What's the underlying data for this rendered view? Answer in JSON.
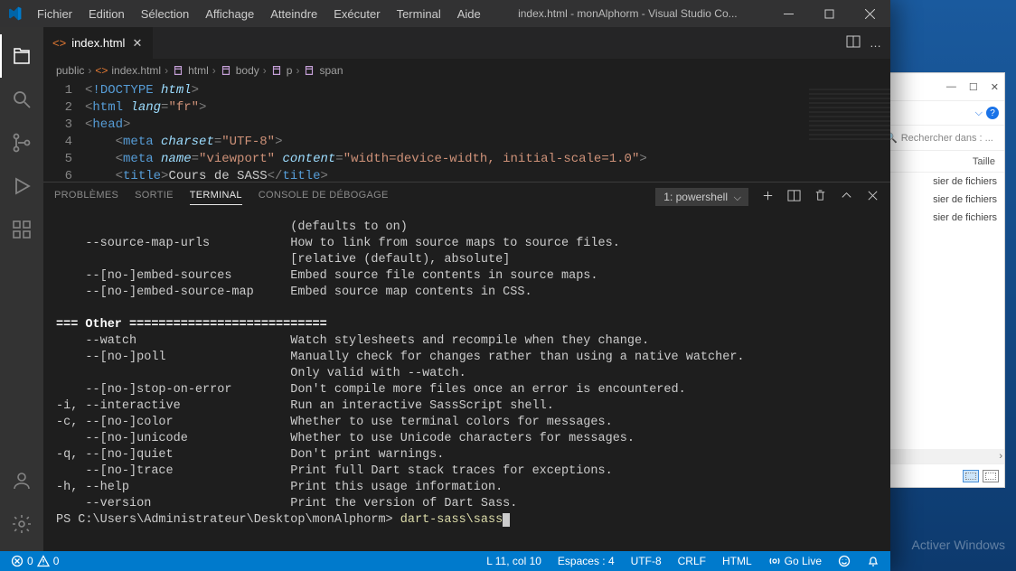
{
  "menu": [
    "Fichier",
    "Edition",
    "Sélection",
    "Affichage",
    "Atteindre",
    "Exécuter",
    "Terminal",
    "Aide"
  ],
  "window_title": "index.html - monAlphorm - Visual Studio Co...",
  "tab": {
    "label": "index.html"
  },
  "breadcrumb": [
    {
      "label": "public",
      "type": "folder"
    },
    {
      "label": "index.html",
      "type": "file"
    },
    {
      "label": "html",
      "type": "sym"
    },
    {
      "label": "body",
      "type": "sym"
    },
    {
      "label": "p",
      "type": "sym"
    },
    {
      "label": "span",
      "type": "sym"
    }
  ],
  "code": {
    "lines": [
      {
        "n": "1",
        "html": "<span class='tok-br'>&lt;</span><span class='tok-exc'>!</span><span class='tok-doc'>DOCTYPE</span> <span class='tok-attr'>html</span><span class='tok-br'>&gt;</span>"
      },
      {
        "n": "2",
        "html": "<span class='tok-br'>&lt;</span><span class='tok-tag'>html</span> <span class='tok-attr'>lang</span><span class='tok-br'>=</span><span class='tok-str'>\"fr\"</span><span class='tok-br'>&gt;</span>"
      },
      {
        "n": "3",
        "html": "<span class='tok-br'>&lt;</span><span class='tok-tag'>head</span><span class='tok-br'>&gt;</span>"
      },
      {
        "n": "4",
        "html": "    <span class='tok-br'>&lt;</span><span class='tok-tag'>meta</span> <span class='tok-attr'>charset</span><span class='tok-br'>=</span><span class='tok-str'>\"UTF-8\"</span><span class='tok-br'>&gt;</span>"
      },
      {
        "n": "5",
        "html": "    <span class='tok-br'>&lt;</span><span class='tok-tag'>meta</span> <span class='tok-attr'>name</span><span class='tok-br'>=</span><span class='tok-str'>\"viewport\"</span> <span class='tok-attr'>content</span><span class='tok-br'>=</span><span class='tok-str'>\"width=device-width, initial-scale=1.0\"</span><span class='tok-br'>&gt;</span>"
      },
      {
        "n": "6",
        "html": "    <span class='tok-br'>&lt;</span><span class='tok-tag'>title</span><span class='tok-br'>&gt;</span>Cours de SASS<span class='tok-br'>&lt;/</span><span class='tok-tag'>title</span><span class='tok-br'>&gt;</span>"
      }
    ]
  },
  "panel_tabs": {
    "problems": "PROBLÈMES",
    "output": "SORTIE",
    "terminal": "TERMINAL",
    "debug": "CONSOLE DE DÉBOGAGE"
  },
  "terminal_selector": "1: powershell",
  "terminal_lines": [
    "                                (defaults to on)",
    "    --source-map-urls           How to link from source maps to source files.",
    "                                [relative (default), absolute]",
    "    --[no-]embed-sources        Embed source file contents in source maps.",
    "    --[no-]embed-source-map     Embed source map contents in CSS.",
    "",
    "BOLD=== Other ===========================",
    "    --watch                     Watch stylesheets and recompile when they change.",
    "    --[no-]poll                 Manually check for changes rather than using a native watcher.",
    "                                Only valid with --watch.",
    "    --[no-]stop-on-error        Don't compile more files once an error is encountered.",
    "-i, --interactive               Run an interactive SassScript shell.",
    "-c, --[no-]color                Whether to use terminal colors for messages.",
    "    --[no-]unicode              Whether to use Unicode characters for messages.",
    "-q, --[no-]quiet                Don't print warnings.",
    "    --[no-]trace                Print full Dart stack traces for exceptions.",
    "-h, --help                      Print this usage information.",
    "    --version                   Print the version of Dart Sass."
  ],
  "prompt_path": "PS C:\\Users\\Administrateur\\Desktop\\monAlphorm> ",
  "prompt_cmd": "dart-sass\\sass",
  "statusbar": {
    "errors": "0",
    "warnings": "0",
    "ln_col": "L 11, col 10",
    "spaces": "Espaces : 4",
    "encoding": "UTF-8",
    "eol": "CRLF",
    "lang": "HTML",
    "golive": "Go Live"
  },
  "explorer": {
    "search_placeholder": "Rechercher dans : ...",
    "col_size": "Taille",
    "rows": [
      "sier de fichiers",
      "sier de fichiers",
      "sier de fichiers"
    ]
  },
  "watermark": {
    "line1": "Activer Windows",
    "line2": ""
  }
}
